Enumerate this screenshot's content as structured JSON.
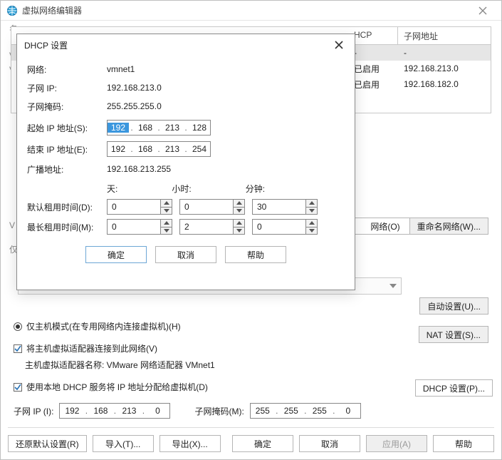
{
  "window": {
    "title": "虚拟网络编辑器"
  },
  "grid": {
    "headers": {
      "dhcp": "HCP",
      "subnet": "子网地址"
    },
    "rows": [
      {
        "dhcp": "-",
        "subnet": "-"
      },
      {
        "dhcp": "已启用",
        "subnet": "192.168.213.0"
      },
      {
        "dhcp": "已启用",
        "subnet": "192.168.182.0"
      }
    ],
    "ghost1": "名",
    "ghost2": "V",
    "ghost3": "V",
    "ghost4": "V",
    "ghost5": "仅"
  },
  "actions": {
    "rename": "重命名网络(W)...",
    "network": "网络(O)",
    "autoset": "自动设置(U)...",
    "natset": "NAT 设置(S)..."
  },
  "hostonly": {
    "radio": "仅主机模式(在专用网络内连接虚拟机)(H)",
    "connect": "将主机虚拟适配器连接到此网络(V)",
    "adapter_prefix": "主机虚拟适配器名称: ",
    "adapter": "VMware 网络适配器 VMnet1",
    "use_dhcp": "使用本地 DHCP 服务将 IP 地址分配给虚拟机(D)",
    "dhcp_btn": "DHCP 设置(P)...",
    "subnet_ip_label": "子网 IP (I):",
    "subnet_ip": {
      "a": "192",
      "b": "168",
      "c": "213",
      "d": "0"
    },
    "mask_label": "子网掩码(M):",
    "mask": {
      "a": "255",
      "b": "255",
      "c": "255",
      "d": "0"
    }
  },
  "footer": {
    "restore": "还原默认设置(R)",
    "import": "导入(T)...",
    "export": "导出(X)...",
    "ok": "确定",
    "cancel": "取消",
    "apply": "应用(A)",
    "help": "帮助"
  },
  "dialog": {
    "title": "DHCP 设置",
    "labels": {
      "network": "网络:",
      "subnet_ip": "子网 IP:",
      "mask": "子网掩码:",
      "start": "起始 IP 地址(S):",
      "end": "结束 IP 地址(E):",
      "broadcast": "广播地址:",
      "days": "天:",
      "hours": "小时:",
      "minutes": "分钟:",
      "default_lease": "默认租用时间(D):",
      "max_lease": "最长租用时间(M):"
    },
    "values": {
      "network": "vmnet1",
      "subnet_ip": "192.168.213.0",
      "mask": "255.255.255.0",
      "broadcast": "192.168.213.255"
    },
    "start_ip": {
      "a": "192",
      "b": "168",
      "c": "213",
      "d": "128"
    },
    "end_ip": {
      "a": "192",
      "b": "168",
      "c": "213",
      "d": "254"
    },
    "default_lease": {
      "days": "0",
      "hours": "0",
      "minutes": "30"
    },
    "max_lease": {
      "days": "0",
      "hours": "2",
      "minutes": "0"
    },
    "buttons": {
      "ok": "确定",
      "cancel": "取消",
      "help": "帮助"
    }
  }
}
